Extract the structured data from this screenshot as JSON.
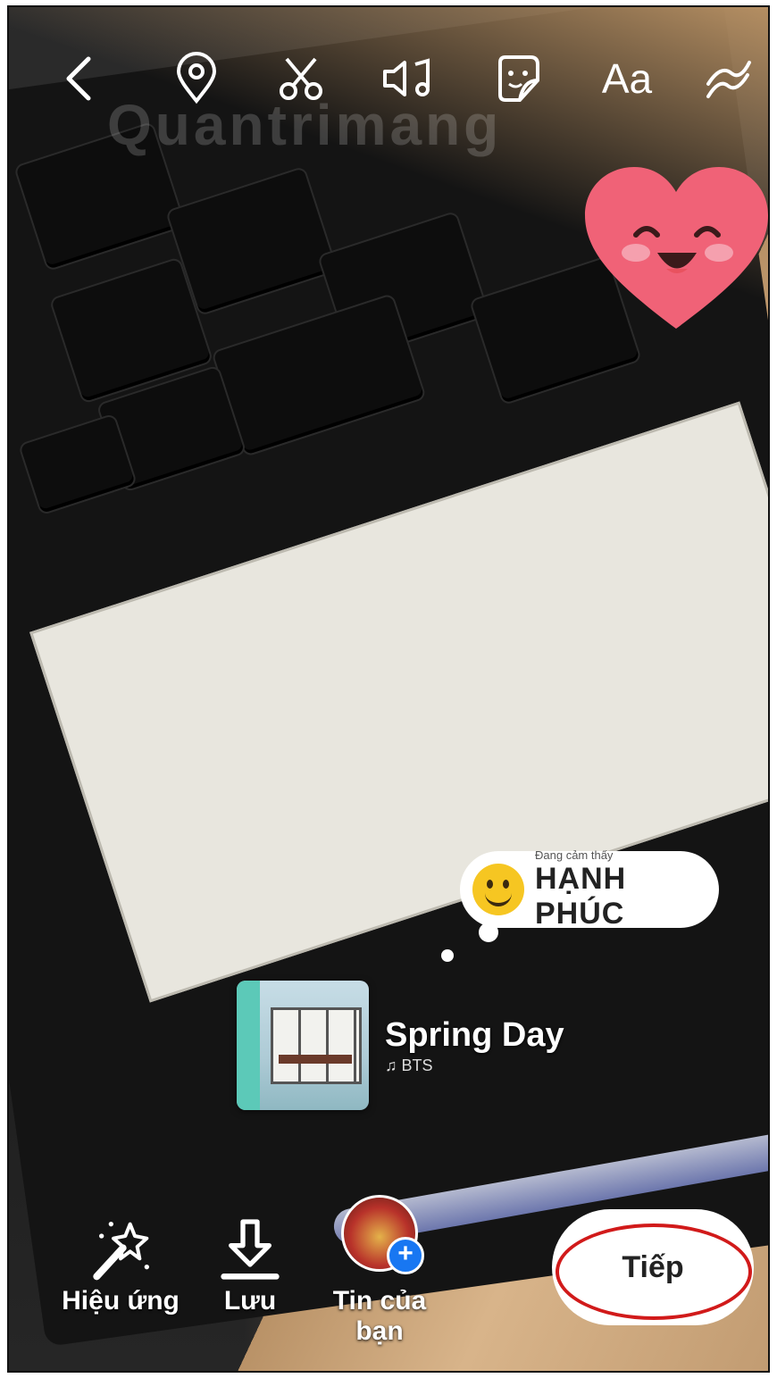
{
  "watermark": "Quantrimang",
  "topbar": {
    "icons": [
      "back-icon",
      "location-icon",
      "scissors-icon",
      "music-note-icon",
      "sticker-icon",
      "text-icon",
      "draw-icon"
    ],
    "text_label": "Aa"
  },
  "feeling_sticker": {
    "caption": "Đang cảm thấy",
    "feeling": "HẠNH PHÚC"
  },
  "music_sticker": {
    "song": "Spring Day",
    "artist": "BTS"
  },
  "bottom": {
    "effects_label": "Hiệu ứng",
    "save_label": "Lưu",
    "story_label": "Tin của bạn",
    "next_label": "Tiếp"
  },
  "colors": {
    "highlight_ring": "#d11a1a",
    "plus_badge": "#1877f2"
  }
}
